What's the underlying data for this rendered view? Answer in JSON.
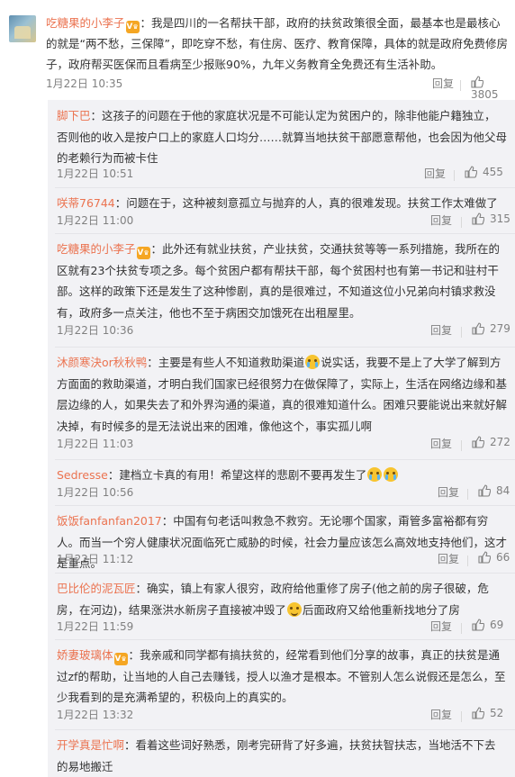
{
  "main": {
    "user": "吃糖果的小李子",
    "colon": "：",
    "text": "我是四川的一名帮扶干部，政府的扶贫政策很全面，最基本也是最核心的就是“两不愁，三保障”，即吃穿不愁，有住房、医疗、教育保障，具体的就是政府免费修房子，政府帮买医保而且看病至少报账90%，九年义务教育全免费还有生活补助。",
    "time": "1月22日 10:35",
    "reply": "回复",
    "likes": "3805"
  },
  "replies": [
    {
      "user": "脚下巴",
      "text": "：这孩子的问题在于他的家庭状况是不可能认定为贫困户的，除非他能户籍独立，否则他的收入是按户口上的家庭人口均分……就算当地扶贫干部愿意帮他，也会因为他父母的老赖行为而被卡住",
      "time": "1月22日 10:51",
      "reply": "回复",
      "likes": "455"
    },
    {
      "user": "咲蒂76744",
      "text": "：问题在于，这种被刻意孤立与抛弃的人，真的很难发现。扶贫工作太难做了",
      "time": "1月22日 11:00",
      "reply": "回复",
      "likes": "315"
    },
    {
      "user": "吃糖果的小李子",
      "text": "：此外还有就业扶贫，产业扶贫，交通扶贫等等一系列措施，我所在的区就有23个扶贫专项之多。每个贫困户都有帮扶干部，每个贫困村也有第一书记和驻村干部。这样的政策下还是发生了这种惨剧，真的是很难过，不知道这位小兄弟向村镇求救没有，政府多一点关注，他也不至于病困交加饿死在出租屋里。",
      "time": "1月22日 10:36",
      "reply": "回复",
      "likes": "279"
    },
    {
      "user": "沐颜寒決or秋秋鸭",
      "text_a": "：主要是有些人不知道救助渠道",
      "text_b": "说实话，我要不是上了大学了解到方方面面的救助渠道，才明白我们国家已经很努力在做保障了，实际上，生活在网络边缘和基层边缘的人，如果失去了和外界沟通的渠道，真的很难知道什么。困难只要能说出来就好解决掉，有时候多的是无法说出来的困难，像他这个，事实孤儿啊",
      "time": "1月22日 11:03",
      "reply": "回复",
      "likes": "272"
    },
    {
      "user": "Sedresse",
      "text": "：建档立卡真的有用！希望这样的悲剧不要再发生了",
      "time": "1月22日 10:56",
      "reply": "回复",
      "likes": "84"
    },
    {
      "user": "饭饭fanfanfan2017",
      "text": "：中国有句老话叫救急不救穷。无论哪个国家，甭管多富裕都有穷人。而当一个穷人健康状况面临死亡威胁的时候，社会力量应该怎么高效地支持他们，这才是重点。",
      "time": "1月22日 11:12",
      "reply": "回复",
      "likes": "66"
    },
    {
      "user": "巴比伦的泥瓦匠",
      "text_a": "：确实，镇上有家人很穷，政府给他重修了房子(他之前的房子很破，危房，在河边)，结果涨洪水新房子直接被冲毁了",
      "text_b": "后面政府又给他重新找地分了房",
      "time": "1月22日 11:59",
      "reply": "回复",
      "likes": "69"
    },
    {
      "user": "娇妻玻璃体",
      "text": "：我亲戚和同学都有搞扶贫的，经常看到他们分享的故事，真正的扶贫是通过zf的帮助，让当地的人自己去赚钱，授人以渔才是根本。不管别人怎么说假还是怎么，至少我看到的是充满希望的，积极向上的真实的。",
      "time": "1月22日 13:32",
      "reply": "回复",
      "likes": "52"
    },
    {
      "user": "开学真是忙啊",
      "text": "：看着这些词好熟悉，刚考完研背了好多遍，扶贫扶智扶志，当地活不下去的易地搬迁"
    }
  ],
  "icons": {
    "avatar": "avatar-image",
    "vip": "vip-badge-icon",
    "like": "thumb-up-icon",
    "cry": "crying-emoji-icon",
    "smile": "laugh-sweat-emoji-icon"
  },
  "colors": {
    "username": "#eb7350",
    "panel_bg": "#f2f2f5",
    "meta": "#808080",
    "text": "#333333"
  }
}
